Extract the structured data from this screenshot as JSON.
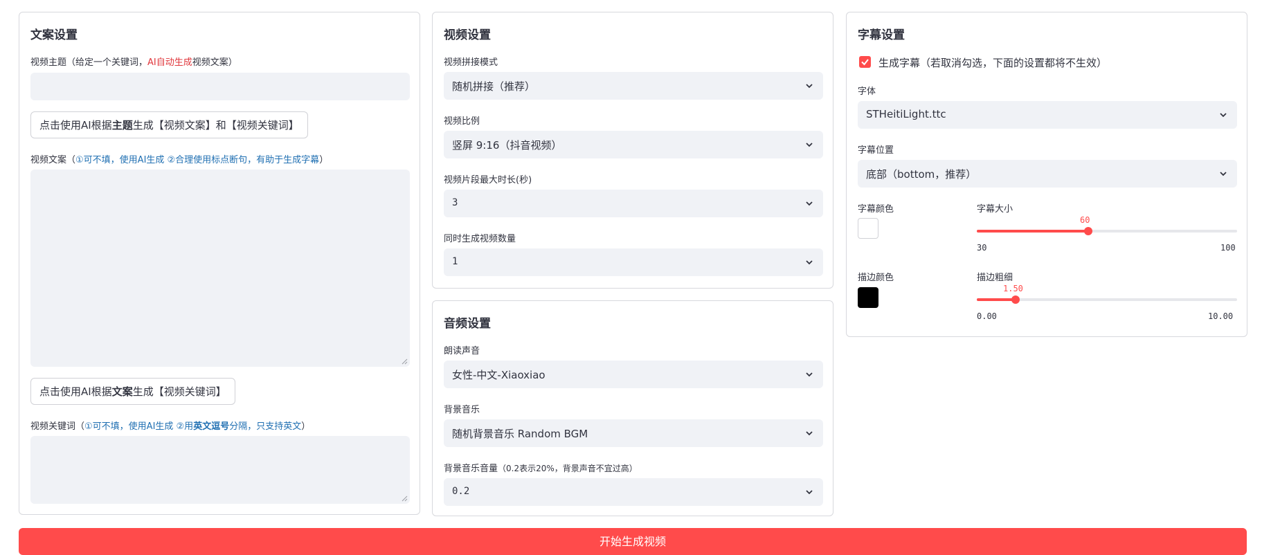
{
  "copy_panel": {
    "title": "文案设置",
    "subject_label": {
      "a": "视频主题（给定一个关键词，",
      "b": "AI自动生成",
      "c": "视频文案）"
    },
    "subject_value": "",
    "gen_script_button": {
      "a": "点击使用AI根据",
      "b": "主题",
      "c": "生成【视频文案】和【视频关键词】"
    },
    "script_label": {
      "a": "视频文案（",
      "b": "①可不填，使用AI生成 ②合理使用标点断句，有助于生成字幕",
      "c": "）"
    },
    "script_value": "",
    "gen_keywords_button": {
      "a": "点击使用AI根据",
      "b": "文案",
      "c": "生成【视频关键词】"
    },
    "keywords_label": {
      "a": "视频关键词（",
      "b": "①可不填，使用AI生成 ②用",
      "c": "英文逗号",
      "d": "分隔，只支持英文",
      "e": "）"
    },
    "keywords_value": ""
  },
  "video_panel": {
    "title": "视频设置",
    "concat_label": "视频拼接模式",
    "concat_value": "随机拼接（推荐）",
    "ratio_label": "视频比例",
    "ratio_value": "竖屏 9:16（抖音视频）",
    "clip_label": "视频片段最大时长(秒)",
    "clip_value": "3",
    "count_label": "同时生成视频数量",
    "count_value": "1"
  },
  "audio_panel": {
    "title": "音频设置",
    "voice_label": "朗读声音",
    "voice_value": "女性-中文-Xiaoxiao",
    "bgm_label": "背景音乐",
    "bgm_value": "随机背景音乐 Random BGM",
    "bgm_volume_label": {
      "a": "背景音乐音量",
      "b": "（0.2表示20%，背景声音不宜过高）"
    },
    "bgm_volume_value": "0.2"
  },
  "subtitle_panel": {
    "title": "字幕设置",
    "enable_label": "生成字幕（若取消勾选，下面的设置都将不生效）",
    "enable_checked": true,
    "font_label": "字体",
    "font_value": "STHeitiLight.ttc",
    "position_label": "字幕位置",
    "position_value": "底部（bottom，推荐）",
    "color_label": "字幕颜色",
    "color_value": "#FFFFFF",
    "size_label": "字幕大小",
    "size_value": "60",
    "size_min": "30",
    "size_max": "100",
    "size_fraction": 0.4286,
    "stroke_color_label": "描边颜色",
    "stroke_color_value": "#000000",
    "stroke_label": "描边粗细",
    "stroke_value": "1.50",
    "stroke_min": "0.00",
    "stroke_max": "10.00",
    "stroke_fraction": 0.15
  },
  "start_button": "开始生成视频",
  "colors": {
    "accent": "#ff4b4b",
    "link": "#1f6fb2",
    "field_bg": "#f0f2f6"
  }
}
